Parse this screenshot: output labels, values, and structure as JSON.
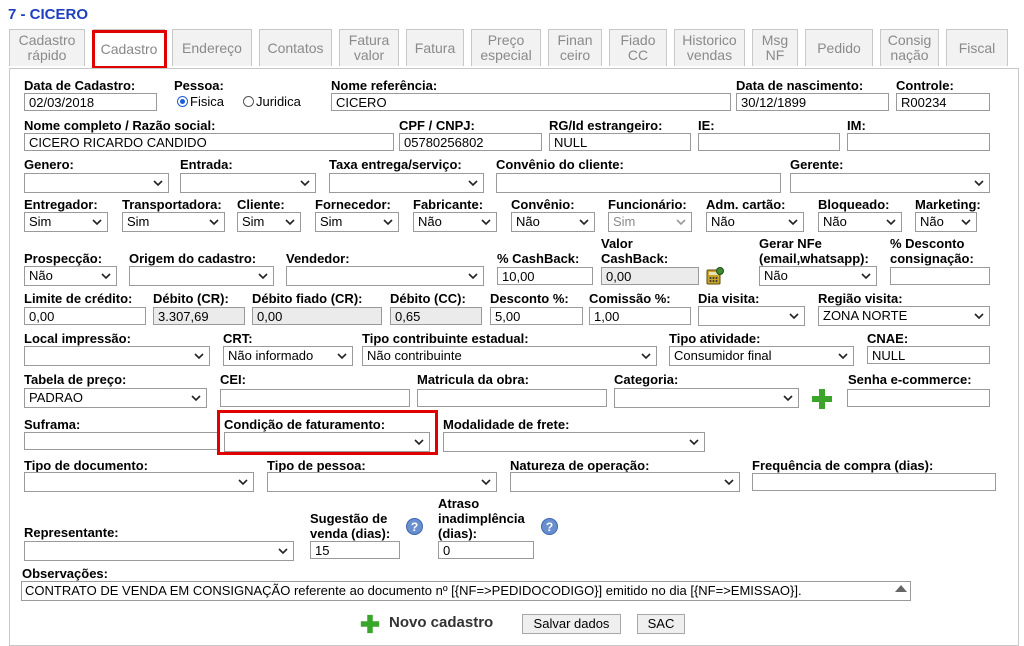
{
  "title": "7 - CICERO",
  "tabs": [
    {
      "label": "Cadastro rápido"
    },
    {
      "label": "Cadastro"
    },
    {
      "label": "Endereço"
    },
    {
      "label": "Contatos"
    },
    {
      "label": "Fatura valor"
    },
    {
      "label": "Fatura"
    },
    {
      "label": "Preço especial"
    },
    {
      "label": "Finan ceiro"
    },
    {
      "label": "Fiado CC"
    },
    {
      "label": "Historico vendas"
    },
    {
      "label": "Msg NF"
    },
    {
      "label": "Pedido"
    },
    {
      "label": "Consig nação"
    },
    {
      "label": "Fiscal"
    }
  ],
  "form": {
    "data_cadastro": {
      "label": "Data de Cadastro:",
      "value": "02/03/2018"
    },
    "pessoa": {
      "label": "Pessoa:",
      "fisica": "Fisica",
      "juridica": "Juridica"
    },
    "nome_referencia": {
      "label": "Nome referência:",
      "value": "CICERO"
    },
    "data_nascimento": {
      "label": "Data de nascimento:",
      "value": "30/12/1899"
    },
    "controle": {
      "label": "Controle:",
      "value": "R00234"
    },
    "nome_completo": {
      "label": "Nome completo / Razão social:",
      "value": "CICERO RICARDO CANDIDO"
    },
    "cpf_cnpj": {
      "label": "CPF / CNPJ:",
      "value": "05780256802"
    },
    "rg": {
      "label": "RG/Id estrangeiro:",
      "value": "NULL"
    },
    "ie": {
      "label": "IE:",
      "value": ""
    },
    "im": {
      "label": "IM:",
      "value": ""
    },
    "genero": {
      "label": "Genero:",
      "value": ""
    },
    "entrada": {
      "label": "Entrada:",
      "value": ""
    },
    "taxa_entrega": {
      "label": "Taxa entrega/serviço:",
      "value": ""
    },
    "convenio_cliente": {
      "label": "Convênio do cliente:",
      "value": ""
    },
    "gerente": {
      "label": "Gerente:",
      "value": ""
    },
    "entregador": {
      "label": "Entregador:",
      "value": "Sim"
    },
    "transportadora": {
      "label": "Transportadora:",
      "value": "Sim"
    },
    "cliente": {
      "label": "Cliente:",
      "value": "Sim"
    },
    "fornecedor": {
      "label": "Fornecedor:",
      "value": "Sim"
    },
    "fabricante": {
      "label": "Fabricante:",
      "value": "Não"
    },
    "convenio": {
      "label": "Convênio:",
      "value": "Não"
    },
    "funcionario": {
      "label": "Funcionário:",
      "value": "Sim"
    },
    "adm_cartao": {
      "label": "Adm. cartão:",
      "value": "Não"
    },
    "bloqueado": {
      "label": "Bloqueado:",
      "value": "Não"
    },
    "marketing": {
      "label": "Marketing:",
      "value": "Não"
    },
    "prospeccao": {
      "label": "Prospecção:",
      "value": "Não"
    },
    "origem_cadastro": {
      "label": "Origem do cadastro:",
      "value": ""
    },
    "vendedor": {
      "label": "Vendedor:",
      "value": ""
    },
    "cashback_pct": {
      "label": "% CashBack:",
      "value": "10,00"
    },
    "valor_cashback": {
      "label": "Valor CashBack:",
      "value": "0,00"
    },
    "gerar_nfe": {
      "label": "Gerar NFe (email,whatsapp):",
      "value": "Não"
    },
    "desconto_consignacao": {
      "label": "% Desconto consignação:",
      "value": ""
    },
    "limite_credito": {
      "label": "Limite de crédito:",
      "value": "0,00"
    },
    "debito_cr": {
      "label": "Débito (CR):",
      "value": "3.307,69"
    },
    "debito_fiado": {
      "label": "Débito fiado (CR):",
      "value": "0,00"
    },
    "debito_cc": {
      "label": "Débito (CC):",
      "value": "0,65"
    },
    "desconto_pct": {
      "label": "Desconto %:",
      "value": "5,00"
    },
    "comissao_pct": {
      "label": "Comissão %:",
      "value": "1,00"
    },
    "dia_visita": {
      "label": "Dia visita:",
      "value": ""
    },
    "regiao_visita": {
      "label": "Região visita:",
      "value": "ZONA NORTE"
    },
    "local_impressao": {
      "label": "Local impressão:",
      "value": ""
    },
    "crt": {
      "label": "CRT:",
      "value": "Não informado"
    },
    "tipo_contribuinte": {
      "label": "Tipo contribuinte estadual:",
      "value": "Não contribuinte"
    },
    "tipo_atividade": {
      "label": "Tipo atividade:",
      "value": "Consumidor final"
    },
    "cnae": {
      "label": "CNAE:",
      "value": "NULL"
    },
    "tabela_preco": {
      "label": "Tabela de preço:",
      "value": "PADRAO"
    },
    "cei": {
      "label": "CEI:",
      "value": ""
    },
    "matricula_obra": {
      "label": "Matricula da obra:",
      "value": ""
    },
    "categoria": {
      "label": "Categoria:",
      "value": ""
    },
    "senha_ecommerce": {
      "label": "Senha e-commerce:",
      "value": ""
    },
    "suframa": {
      "label": "Suframa:",
      "value": ""
    },
    "condicao_faturamento": {
      "label": "Condição de faturamento:",
      "value": ""
    },
    "modalidade_frete": {
      "label": "Modalidade de frete:",
      "value": ""
    },
    "tipo_documento": {
      "label": "Tipo de documento:",
      "value": ""
    },
    "tipo_pessoa": {
      "label": "Tipo de pessoa:",
      "value": ""
    },
    "natureza_operacao": {
      "label": "Natureza de operação:",
      "value": ""
    },
    "frequencia_compra": {
      "label": "Frequência de compra (dias):",
      "value": ""
    },
    "representante": {
      "label": "Representante:",
      "value": ""
    },
    "sugestao_venda": {
      "label": "Sugestão de venda (dias):",
      "value": "15"
    },
    "atraso_inadimplencia": {
      "label": "Atraso inadimplência (dias):",
      "value": "0"
    },
    "observacoes": {
      "label": "Observações:",
      "value": "CONTRATO DE VENDA EM CONSIGNAÇÃO referente ao documento nº [{NF=>PEDIDOCODIGO}] emitido no dia [{NF=>EMISSAO}]."
    }
  },
  "buttons": {
    "novo_cadastro": "Novo cadastro",
    "salvar": "Salvar dados",
    "sac": "SAC",
    "help": "?"
  },
  "colors": {
    "accent": "#1e3fbf",
    "highlight": "#e00000",
    "plus": "#3aa52a"
  }
}
